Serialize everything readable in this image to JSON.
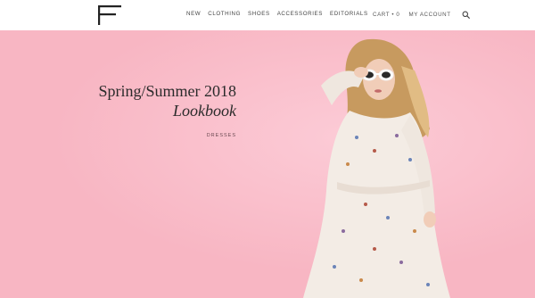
{
  "header": {
    "logo_icon": "F-logo-icon",
    "nav": [
      "NEW",
      "CLOTHING",
      "SHOES",
      "ACCESSORIES",
      "EDITORIALS"
    ],
    "cart_label": "CART • 0",
    "account_label": "MY ACCOUNT",
    "search_icon": "search-icon"
  },
  "hero": {
    "title_line1": "Spring/Summer 2018",
    "title_line2": "Lookbook",
    "category_link": "DRESSES",
    "background_color": "#f8b6c3"
  }
}
